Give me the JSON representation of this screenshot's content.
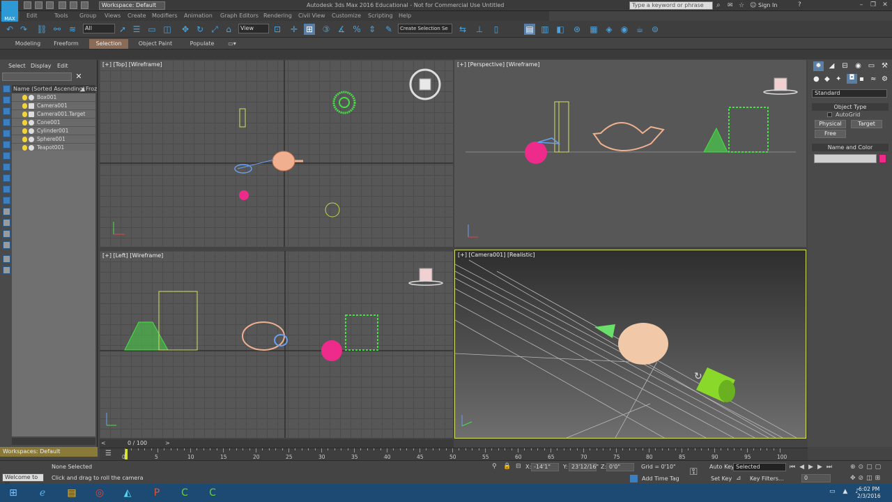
{
  "app": {
    "logo_label": "MAX",
    "workspace": "Workspace: Default",
    "title": "Autodesk 3ds Max 2016 Educational - Not for Commercial Use   Untitled",
    "search_placeholder": "Type a keyword or phrase",
    "signin": "Sign In"
  },
  "menubar": [
    "Edit",
    "Tools",
    "Group",
    "Views",
    "Create",
    "Modifiers",
    "Animation",
    "Graph Editors",
    "Rendering",
    "Civil View",
    "Customize",
    "Scripting",
    "Help"
  ],
  "toolbar": {
    "selection_filter": "All",
    "ref_coord": "View",
    "named_selection": "Create Selection Se"
  },
  "ribbon_tabs": [
    "Modeling",
    "Freeform",
    "Selection",
    "Object Paint",
    "Populate"
  ],
  "scene_explorer": {
    "menu": [
      "Select",
      "Display",
      "Edit"
    ],
    "column_header": "Name (Sorted Ascending)",
    "column_header2": "Froz",
    "items": [
      "Box001",
      "Camera001",
      "Camera001.Target",
      "Cone001",
      "Cylinder001",
      "Sphere001",
      "Teapot001"
    ]
  },
  "viewports": {
    "top": "[+] [Top] [Wireframe]",
    "perspective": "[+] [Perspective] [Wireframe]",
    "left": "[+] [Left] [Wireframe]",
    "camera": "[+] [Camera001] [Realistic]"
  },
  "command_panel": {
    "category": "Standard",
    "object_type_header": "Object Type",
    "autogrid": "AutoGrid",
    "buttons": [
      "Physical",
      "Target",
      "Free"
    ],
    "name_color_header": "Name and Color"
  },
  "timeslider": {
    "readout": "0 / 100"
  },
  "timeline": {
    "labels": [
      "0",
      "5",
      "10",
      "15",
      "20",
      "25",
      "30",
      "35",
      "40",
      "45",
      "50",
      "55",
      "60",
      "65",
      "70",
      "75",
      "80",
      "85",
      "90",
      "95",
      "100"
    ]
  },
  "status": {
    "workspace_label": "Workspaces: Default",
    "maxscript": "Welcome to M",
    "selection": "None Selected",
    "prompt": "Click and drag to roll the camera",
    "x_label": "X:",
    "x_value": "-14'1\"",
    "y_label": "Y:",
    "y_value": "23'12/16\"",
    "z_label": "Z:",
    "z_value": "0'0\"",
    "grid": "Grid = 0'10\"",
    "add_time_tag": "Add Time Tag",
    "auto_key": "Auto Key",
    "set_key": "Set Key",
    "selected": "Selected",
    "key_filters": "Key Filters...",
    "frame": "0"
  },
  "tray": {
    "time": "6:02 PM",
    "date": "2/3/2016"
  }
}
